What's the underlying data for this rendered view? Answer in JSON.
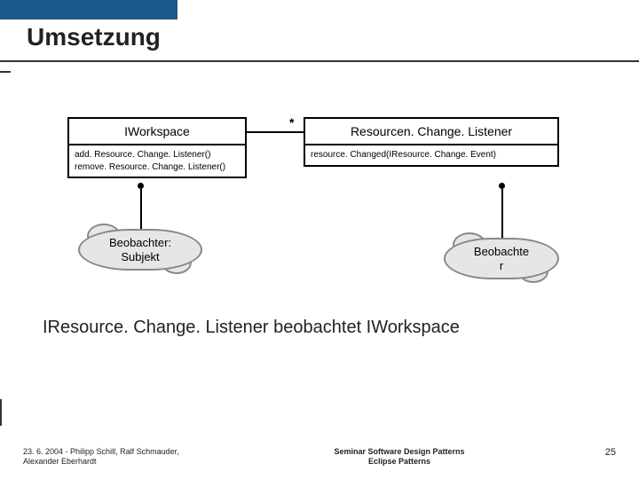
{
  "title": "Umsetzung",
  "uml": {
    "left": {
      "name": "IWorkspace",
      "ops": [
        "add. Resource. Change. Listener()",
        "remove. Resource. Change. Listener()"
      ]
    },
    "right": {
      "name": "Resourcen. Change. Listener",
      "ops": [
        "resource. Changed(IResource. Change. Event)"
      ]
    },
    "multiplicity": "*"
  },
  "clouds": {
    "left": "Beobachter:\nSubjekt",
    "right": "Beobachte\nr"
  },
  "statement": "IResource. Change. Listener beobachtet IWorkspace",
  "footer": {
    "left": "23. 6. 2004 - Philipp Schill, Ralf Schmauder,\nAlexander Eberhardt",
    "center": "Seminar Software Design Patterns\nEclipse Patterns",
    "page": "25"
  }
}
